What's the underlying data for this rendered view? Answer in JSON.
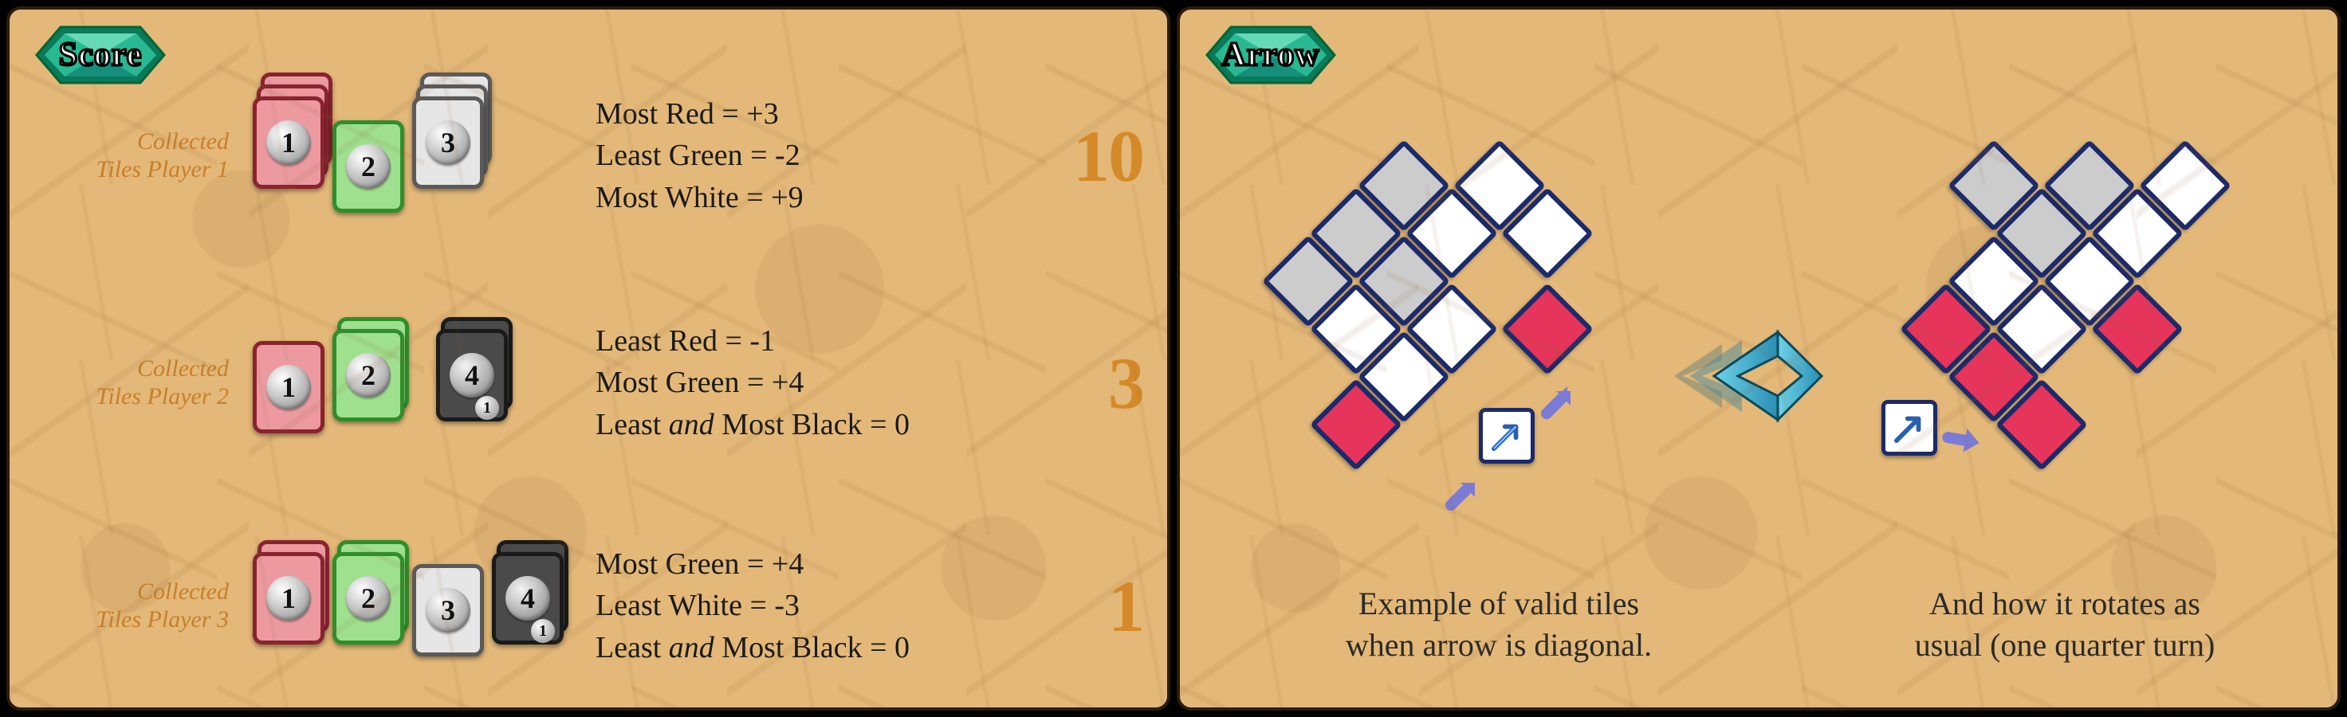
{
  "panels": {
    "score": {
      "badge": "Score",
      "players": [
        {
          "caption_l1": "Collected",
          "caption_l2": "Tiles Player 1",
          "tiles": [
            {
              "color": "red",
              "count": 3,
              "value": "1"
            },
            {
              "color": "green",
              "count": 1,
              "value": "2"
            },
            {
              "color": "white",
              "count": 3,
              "value": "3"
            }
          ],
          "rules": [
            "Most Red = +3",
            "Least Green = -2",
            "Most White = +9"
          ],
          "total": "10"
        },
        {
          "caption_l1": "Collected",
          "caption_l2": "Tiles Player 2",
          "tiles": [
            {
              "color": "red",
              "count": 1,
              "value": "1"
            },
            {
              "color": "green",
              "count": 2,
              "value": "2"
            },
            {
              "color": "black",
              "count": 2,
              "value": "4",
              "sub": "1"
            }
          ],
          "rules": [
            "Least Red = -1",
            "Most Green = +4",
            "Least <em>and</em> Most Black = 0"
          ],
          "total": "3"
        },
        {
          "caption_l1": "Collected",
          "caption_l2": "Tiles Player 3",
          "tiles": [
            {
              "color": "red",
              "count": 2,
              "value": "1"
            },
            {
              "color": "green",
              "count": 2,
              "value": "2"
            },
            {
              "color": "white",
              "count": 1,
              "value": "3"
            },
            {
              "color": "black",
              "count": 2,
              "value": "4",
              "sub": "1"
            }
          ],
          "rules": [
            "Most Green = +4",
            "Least White = -3",
            "Least <em>and</em> Most Black = 0"
          ],
          "total": "1"
        }
      ]
    },
    "arrow": {
      "badge": "Arrow",
      "caption_left_l1": "Example of valid tiles",
      "caption_left_l2": "when arrow is diagonal.",
      "caption_right_l1": "And how it rotates as",
      "caption_right_l2": "usual (one quarter turn)"
    }
  },
  "colors": {
    "tile_border": "#1b2a6b",
    "tile_red": "#e6345a",
    "accent": "#d58a2a"
  }
}
